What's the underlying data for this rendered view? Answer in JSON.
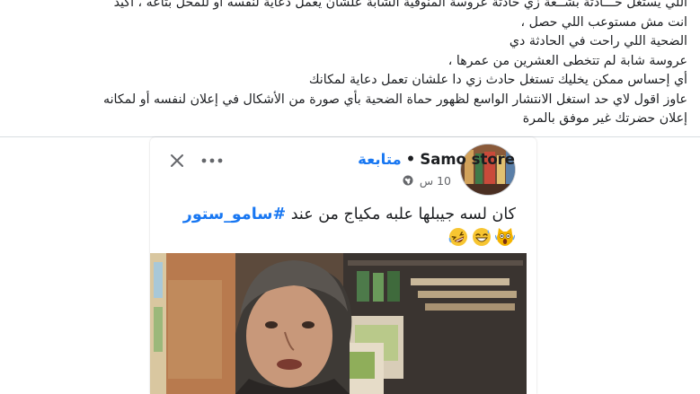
{
  "post": {
    "lines": [
      "اللي يستغل حـــادثة بشــعة زي حادثة عروسة المنوفية الشابة علشان يعمل دعاية لنفسه أو للمحل بتاعه ، اكيد",
      "انت مش مستوعب اللي حصل ،",
      "الضحية اللي راحت في الحادثة دي",
      "عروسة شابة لم تتخطى العشرين من عمرها ،",
      "أي إحساس ممكن يخليك تستغل حادث زي دا علشان تعمل دعاية لمكانك",
      "عاوز اقول لاي حد استغل الانتشار الواسع لظهور حماة الضحية بأي صورة من الأشكال في إعلان لنفسه أو لمكانه",
      "إعلان حضرتك غير موفق بالمرة"
    ]
  },
  "shared_post": {
    "page_name": "Samo store",
    "separator": "•",
    "follow_label": "متابعة",
    "time": "10 س",
    "privacy_icon": "globe-icon",
    "more_icon": "more-options-icon",
    "close_icon": "close-icon",
    "caption_text": "كان لسه جيبلها علبه مكياج من عند",
    "hashtag": "#سامو_ستور",
    "emojis": [
      "cat-scream-emoji",
      "grin-sweat-emoji",
      "rofl-emoji"
    ]
  },
  "colors": {
    "link": "#1877f2",
    "muted": "#65676b",
    "text": "#1c1e21"
  }
}
